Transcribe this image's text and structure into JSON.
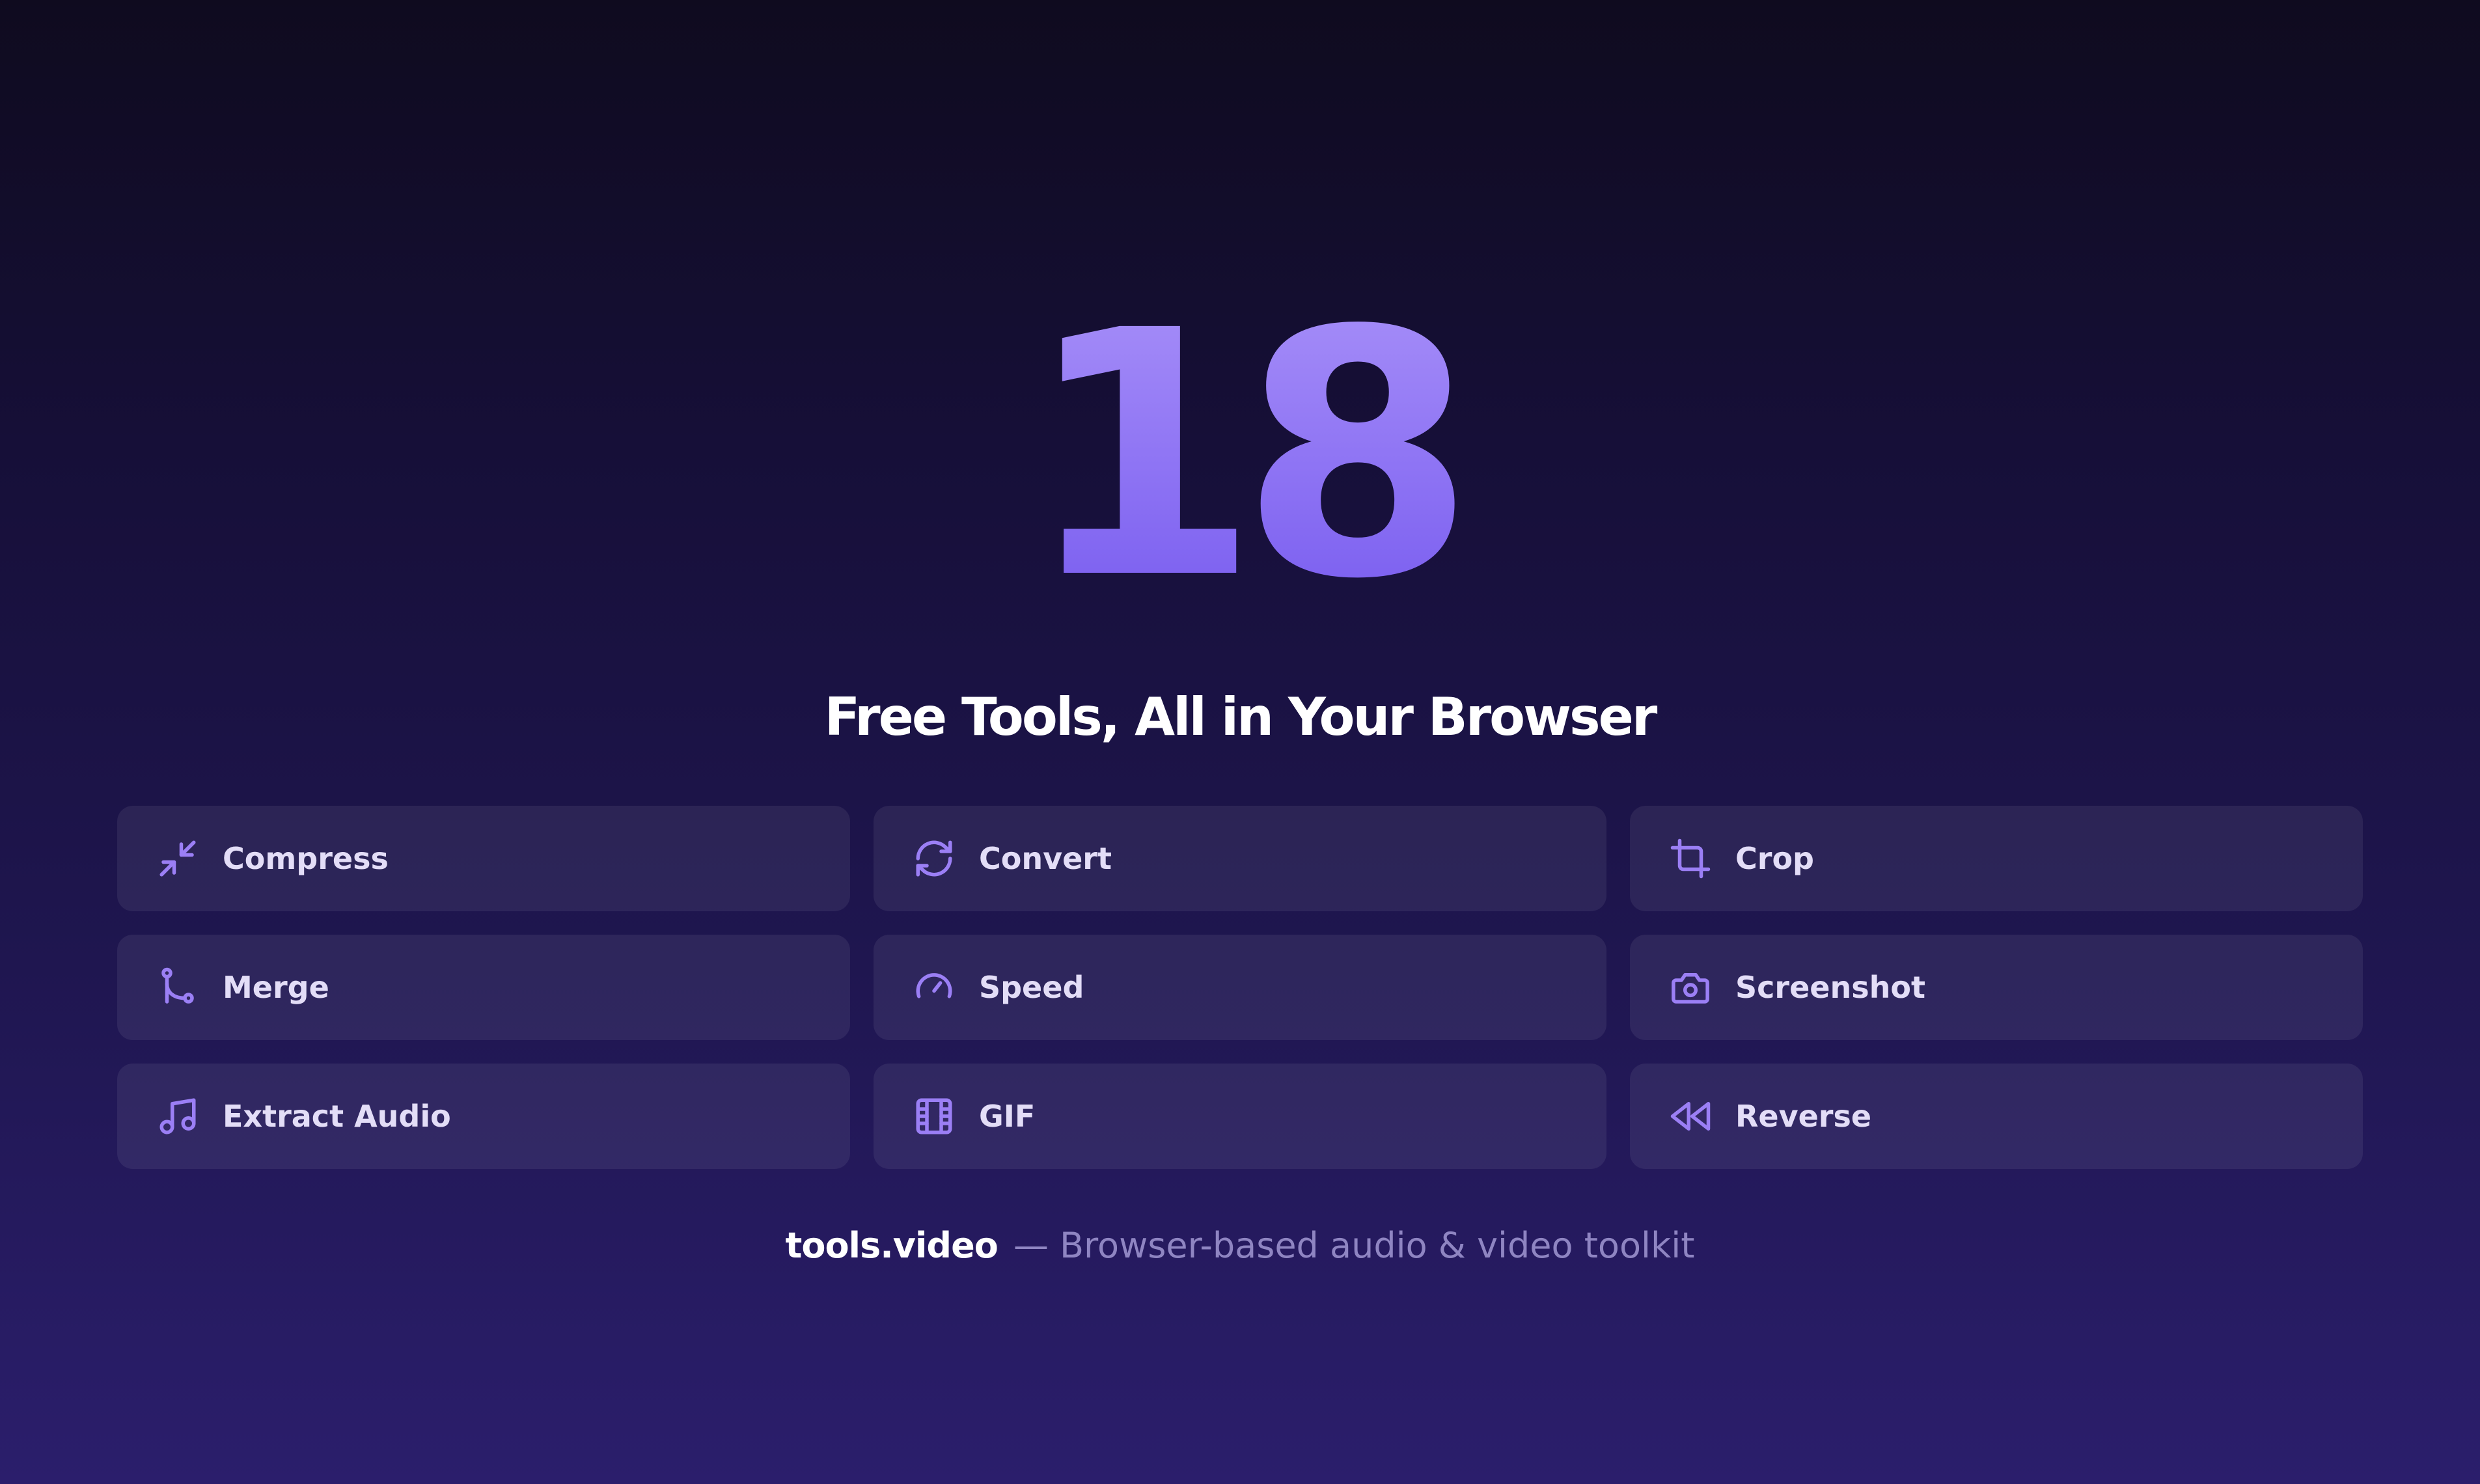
{
  "hero": {
    "number": "18",
    "headline": "Free Tools, All in Your Browser"
  },
  "tools": [
    {
      "label": "Compress",
      "icon": "compress-icon"
    },
    {
      "label": "Convert",
      "icon": "refresh-icon"
    },
    {
      "label": "Crop",
      "icon": "crop-icon"
    },
    {
      "label": "Merge",
      "icon": "merge-icon"
    },
    {
      "label": "Speed",
      "icon": "speedometer-icon"
    },
    {
      "label": "Screenshot",
      "icon": "camera-icon"
    },
    {
      "label": "Extract Audio",
      "icon": "music-note-icon"
    },
    {
      "label": "GIF",
      "icon": "film-icon"
    },
    {
      "label": "Reverse",
      "icon": "rewind-icon"
    }
  ],
  "footer": {
    "brand": "tools.video",
    "tagline": "— Browser-based audio & video toolkit"
  },
  "colors": {
    "accent": "#8b6ff3",
    "background_top": "#0f0b1f",
    "background_bottom": "#2b1e6c",
    "card": "#2a2150"
  }
}
